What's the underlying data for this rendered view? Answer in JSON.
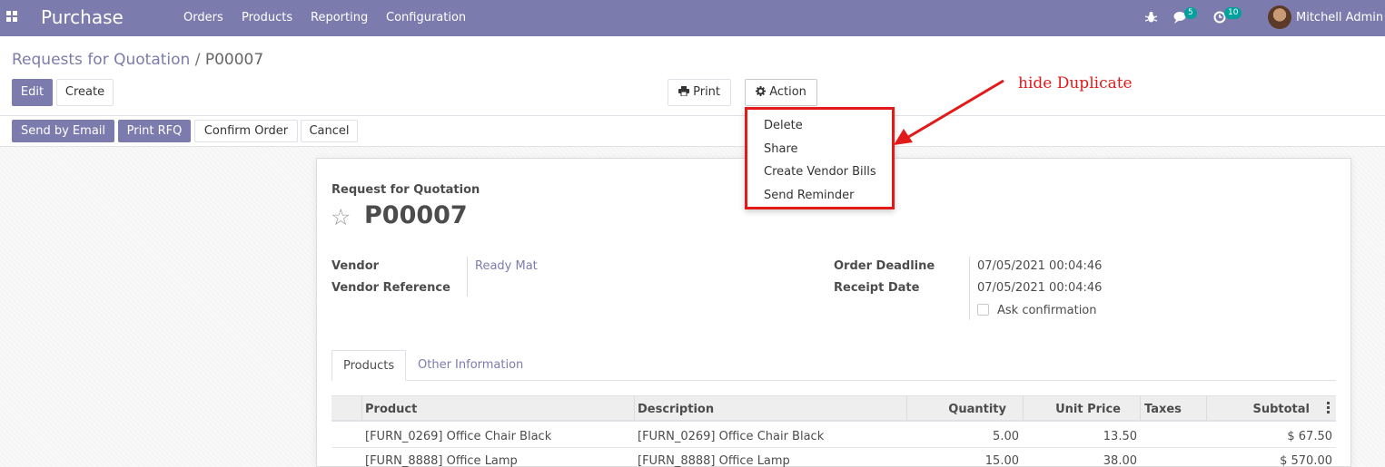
{
  "navbar": {
    "brand": "Purchase",
    "menu": [
      "Orders",
      "Products",
      "Reporting",
      "Configuration"
    ],
    "messages_count": "5",
    "activities_count": "10",
    "user_name": "Mitchell Admin",
    "color": "#7c7bad"
  },
  "breadcrumb": {
    "parent": "Requests for Quotation",
    "separator": "/",
    "current": "P00007"
  },
  "buttons": {
    "edit": "Edit",
    "create": "Create",
    "print": "Print",
    "action": "Action",
    "send_by_email": "Send by Email",
    "print_rfq": "Print RFQ",
    "confirm_order": "Confirm Order",
    "cancel": "Cancel"
  },
  "action_menu": {
    "items": [
      "Delete",
      "Share",
      "Create Vendor Bills",
      "Send Reminder"
    ]
  },
  "annotation": {
    "text": "hide Duplicate",
    "color": "#e21a1a"
  },
  "form": {
    "subtitle": "Request for Quotation",
    "name": "P00007",
    "vendor_label": "Vendor",
    "vendor_value": "Ready Mat",
    "vendor_reference_label": "Vendor Reference",
    "vendor_reference_value": "",
    "order_deadline_label": "Order Deadline",
    "order_deadline_value": "07/05/2021 00:04:46",
    "receipt_date_label": "Receipt Date",
    "receipt_date_value": "07/05/2021 00:04:46",
    "ask_confirmation_label": "Ask confirmation",
    "ask_confirmation_checked": false
  },
  "tabs": [
    "Products",
    "Other Information"
  ],
  "table": {
    "headers": [
      "Product",
      "Description",
      "Quantity",
      "Unit Price",
      "Taxes",
      "Subtotal"
    ],
    "rows": [
      [
        "[FURN_0269] Office Chair Black",
        "[FURN_0269] Office Chair Black",
        "5.00",
        "13.50",
        "",
        "$ 67.50"
      ],
      [
        "[FURN_8888] Office Lamp",
        "[FURN_8888] Office Lamp",
        "15.00",
        "38.00",
        "",
        "$ 570.00"
      ]
    ]
  }
}
